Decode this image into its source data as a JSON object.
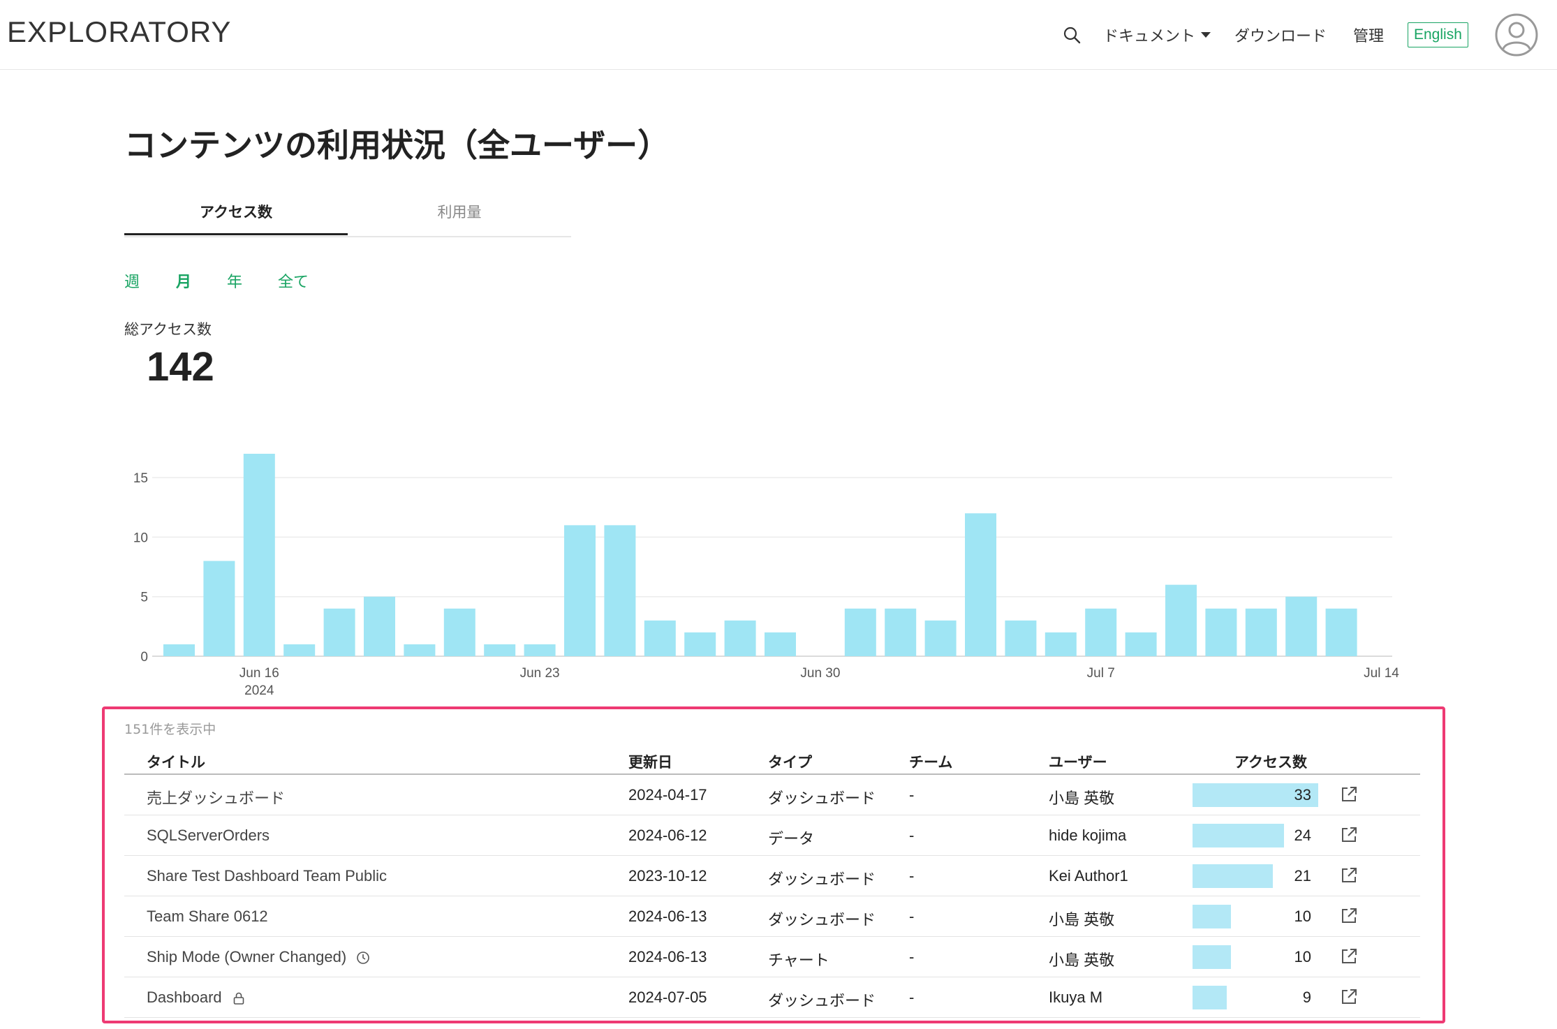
{
  "header": {
    "brand": "EXPLORATORY",
    "nav": {
      "documents": "ドキュメント",
      "download": "ダウンロード",
      "admin": "管理",
      "language": "English"
    }
  },
  "page": {
    "title": "コンテンツの利用状況（全ユーザー）",
    "tabs": [
      {
        "label": "アクセス数",
        "active": true
      },
      {
        "label": "利用量",
        "active": false
      }
    ],
    "periods": [
      {
        "label": "週",
        "active": false
      },
      {
        "label": "月",
        "active": true
      },
      {
        "label": "年",
        "active": false
      },
      {
        "label": "全て",
        "active": false
      }
    ],
    "total_label": "総アクセス数",
    "total_value": "142"
  },
  "chart_data": {
    "type": "bar",
    "x_start": "2024-06-14",
    "values": [
      1,
      8,
      17,
      1,
      4,
      5,
      1,
      4,
      1,
      1,
      11,
      11,
      3,
      2,
      3,
      2,
      0,
      4,
      4,
      3,
      12,
      3,
      2,
      4,
      2,
      6,
      4,
      4,
      5,
      4
    ],
    "x_ticks": [
      {
        "label": "Jun 16",
        "sublabel": "2024",
        "index": 2
      },
      {
        "label": "Jun 23",
        "sublabel": "",
        "index": 9
      },
      {
        "label": "Jun 30",
        "sublabel": "",
        "index": 16
      },
      {
        "label": "Jul 7",
        "sublabel": "",
        "index": 23
      },
      {
        "label": "Jul 14",
        "sublabel": "",
        "index": 30
      }
    ],
    "y_ticks": [
      0,
      5,
      10,
      15
    ],
    "ylim": [
      0,
      17
    ],
    "grid": true,
    "bar_color": "#9fe5f4"
  },
  "table": {
    "count_text": "151件を表示中",
    "headers": {
      "title": "タイトル",
      "updated": "更新日",
      "type": "タイプ",
      "team": "チーム",
      "user": "ユーザー",
      "access": "アクセス数"
    },
    "max_access": 33,
    "rows": [
      {
        "title": "売上ダッシュボード",
        "updated": "2024-04-17",
        "type": "ダッシュボード",
        "team": "-",
        "user": "小島 英敬",
        "access": 33,
        "icon": ""
      },
      {
        "title": "SQLServerOrders",
        "updated": "2024-06-12",
        "type": "データ",
        "team": "-",
        "user": "hide kojima",
        "access": 24,
        "icon": ""
      },
      {
        "title": "Share Test Dashboard Team Public",
        "updated": "2023-10-12",
        "type": "ダッシュボード",
        "team": "-",
        "user": "Kei Author1",
        "access": 21,
        "icon": ""
      },
      {
        "title": "Team Share 0612",
        "updated": "2024-06-13",
        "type": "ダッシュボード",
        "team": "-",
        "user": "小島 英敬",
        "access": 10,
        "icon": ""
      },
      {
        "title": "Ship Mode (Owner Changed)",
        "updated": "2024-06-13",
        "type": "チャート",
        "team": "-",
        "user": "小島 英敬",
        "access": 10,
        "icon": "clock-icon"
      },
      {
        "title": "Dashboard",
        "updated": "2024-07-05",
        "type": "ダッシュボード",
        "team": "-",
        "user": "Ikuya M",
        "access": 9,
        "icon": "lock-icon"
      }
    ]
  },
  "colors": {
    "accent_green": "#19a463",
    "highlight_border": "#ee3a73",
    "bar": "#9fe5f4",
    "table_bar": "#b3e8f6"
  }
}
